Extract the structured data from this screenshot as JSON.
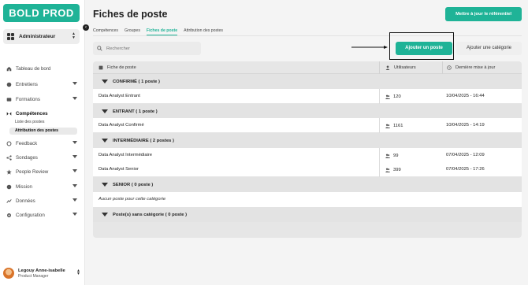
{
  "app": {
    "logo": "BOLD PROD"
  },
  "sidebar": {
    "role": "Administrateur",
    "items": [
      {
        "label": "Tableau de bord"
      },
      {
        "label": "Entretiens"
      },
      {
        "label": "Formations"
      },
      {
        "label": "Compétences"
      },
      {
        "label": "Feedback"
      },
      {
        "label": "Sondages"
      },
      {
        "label": "People Review"
      },
      {
        "label": "Mission"
      },
      {
        "label": "Données"
      },
      {
        "label": "Configuration"
      }
    ],
    "sub_items": [
      {
        "label": "Liste des postes"
      },
      {
        "label": "Attribution des postes"
      }
    ],
    "user": {
      "name": "Legouy Anne-isabelle",
      "role": "Product Manager"
    }
  },
  "header": {
    "title": "Fiches de poste",
    "update_button": "Mettre à jour le référentiel"
  },
  "tabs": [
    {
      "label": "Compétences"
    },
    {
      "label": "Groupes"
    },
    {
      "label": "Fiches de poste"
    },
    {
      "label": "Attribution des postes"
    }
  ],
  "toolbar": {
    "search_placeholder": "Rechercher",
    "add_post": "Ajouter un poste",
    "add_category": "Ajouter une catégorie"
  },
  "table": {
    "columns": [
      "Fiche de poste",
      "Utilisateurs",
      "Dernière mise à jour"
    ],
    "categories": [
      {
        "label": "CONFIRMÉ ( 1 poste )"
      },
      {
        "label": "ENTRANT ( 1 poste )"
      },
      {
        "label": "INTERMÉDIAIRE ( 2 postes )"
      },
      {
        "label": "SENIOR ( 0 poste )"
      },
      {
        "label": "Poste(s) sans catégorie ( 0 poste )"
      }
    ],
    "rows": [
      {
        "name": "Data Analyst Entrant",
        "users": "120",
        "updated": "10/04/2025 - 16:44"
      },
      {
        "name": "Data Analyst Confirmé",
        "users": "1161",
        "updated": "10/04/2025 - 14:19"
      },
      {
        "name": "Data Analyst Intermédiaire",
        "users": "99",
        "updated": "07/04/2025 - 12:09"
      },
      {
        "name": "Data Analyst Senior",
        "users": "399",
        "updated": "07/04/2025 - 17:26"
      }
    ],
    "empty_message": "Aucun poste pour cette catégorie"
  },
  "colors": {
    "accent": "#1fb397"
  }
}
